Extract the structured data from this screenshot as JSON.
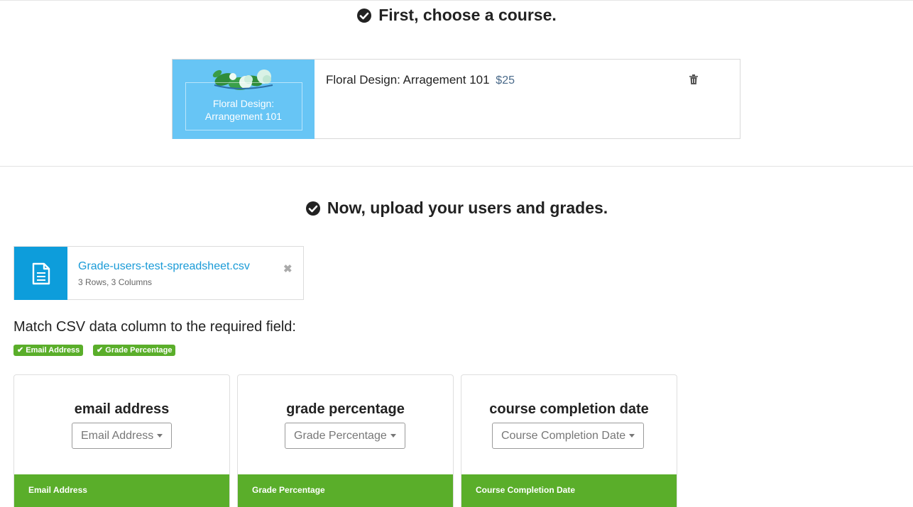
{
  "step1": {
    "title": "First, choose a course."
  },
  "course": {
    "thumbnail_text_line1": "Floral Design:",
    "thumbnail_text_line2": "Arrangement 101",
    "name": "Floral Design: Arragement 101",
    "price": "$25",
    "icon": "trash-icon"
  },
  "step2": {
    "title": "Now, upload your users and grades."
  },
  "file": {
    "name": "Grade-users-test-spreadsheet.csv",
    "meta": "3 Rows, 3 Columns",
    "icon": "document-icon",
    "remove_icon": "close-icon"
  },
  "match": {
    "label": "Match CSV data column to the required field:",
    "badges": [
      {
        "label": "Email Address"
      },
      {
        "label": "Grade Percentage"
      }
    ]
  },
  "columns": [
    {
      "title": "email address",
      "selected": "Email Address",
      "footer": "Email Address"
    },
    {
      "title": "grade percentage",
      "selected": "Grade Percentage",
      "footer": "Grade Percentage"
    },
    {
      "title": "course completion date",
      "selected": "Course Completion Date",
      "footer": "Course Completion Date"
    }
  ],
  "colors": {
    "accent_blue": "#0d9ddb",
    "thumb_blue": "#67c5f5",
    "success_green": "#5aae2a",
    "link_blue": "#1a9bd7"
  }
}
